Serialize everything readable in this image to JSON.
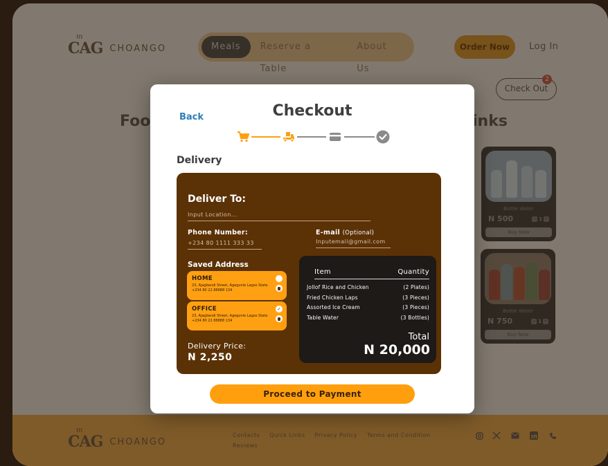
{
  "brand": {
    "name": "CHOANGO",
    "mark": "CAG",
    "mark_sup": "m"
  },
  "nav": {
    "items": [
      "Meals",
      "Reserve a Table",
      "About Us"
    ],
    "active": "Meals"
  },
  "header": {
    "order_now": "Order Now",
    "login": "Log In",
    "checkout": "Check Out",
    "cart_count": "2"
  },
  "background": {
    "heading_left": "Foo",
    "heading_right": "inks",
    "products": [
      {
        "name": "Bottle Water",
        "price": "N 500",
        "qty": "1",
        "buy": "Buy Now"
      },
      {
        "name": "Bottle Water",
        "price": "N 750",
        "qty": "1",
        "buy": "Buy Now"
      }
    ]
  },
  "footer": {
    "links": [
      "Contacts",
      "Quick Links",
      "Privacy Policy",
      "Terms and Condition",
      "Reviews"
    ],
    "social_icons": [
      "instagram-icon",
      "x-icon",
      "mail-icon",
      "linkedin-icon",
      "phone-icon"
    ]
  },
  "checkout": {
    "back": "Back",
    "title": "Checkout",
    "steps": [
      "cart-icon",
      "delivery-truck-icon",
      "card-icon",
      "check-icon"
    ],
    "current_step": 2,
    "section": "Delivery",
    "deliver_to": "Deliver To:",
    "location_placeholder": "Input Location...",
    "phone_label": "Phone Number:",
    "phone_value": "+234 80 1111 333 33",
    "email_label": "E-mail",
    "email_optional": "(Optional)",
    "email_placeholder": "Inputemail@gmail.com",
    "saved_address_label": "Saved Address",
    "addresses": [
      {
        "title": "HOME",
        "line1": "23, Ajagbandi Street, Agegunle Lagos State.",
        "line2": "+234 80 22 88888 134",
        "selected": false
      },
      {
        "title": "OFFICE",
        "line1": "23, Ajagbandi Street, Agegunle Lagos State.",
        "line2": "+234 80 22 88888 134",
        "selected": true
      }
    ],
    "delivery_price_label": "Delivery Price:",
    "delivery_price": "N 2,250",
    "summary": {
      "col_item": "Item",
      "col_qty": "Quantity",
      "rows": [
        {
          "item": "Jollof Rice and Chicken",
          "qty": "(2 Plates)"
        },
        {
          "item": "Fried Chicken Laps",
          "qty": "(3 Pieces)"
        },
        {
          "item": "Assorted Ice Cream",
          "qty": "(3 Pieces)"
        },
        {
          "item": "Table Water",
          "qty": "(3 Bottles)"
        }
      ],
      "total_label": "Total",
      "total_value": "N 20,000"
    },
    "proceed": "Proceed to Payment"
  },
  "colors": {
    "accent": "#ff9f0e",
    "panel": "#5b3106",
    "summary": "#1d1a17",
    "link": "#2e7fb8"
  }
}
